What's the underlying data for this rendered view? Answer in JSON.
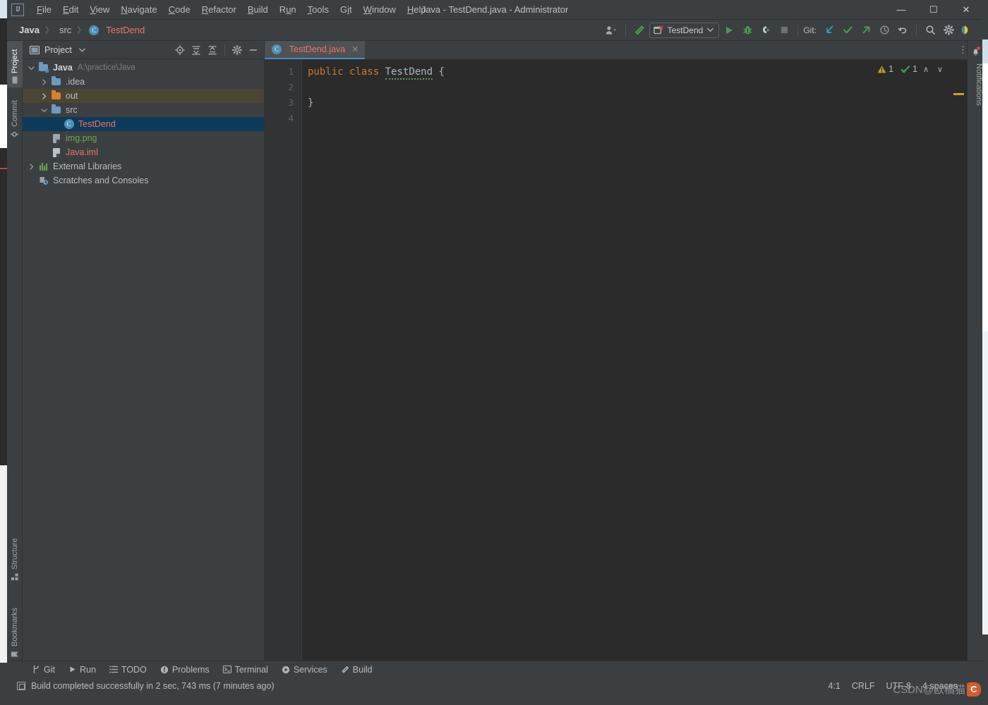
{
  "window": {
    "title": "Java - TestDend.java - Administrator",
    "logo_text": "IJ",
    "minimize": "—",
    "maximize": "☐",
    "close": "✕"
  },
  "menu": [
    {
      "label": "File",
      "mnemonic": "F"
    },
    {
      "label": "Edit",
      "mnemonic": "E"
    },
    {
      "label": "View",
      "mnemonic": "V"
    },
    {
      "label": "Navigate",
      "mnemonic": "N"
    },
    {
      "label": "Code",
      "mnemonic": "C"
    },
    {
      "label": "Refactor",
      "mnemonic": "R"
    },
    {
      "label": "Build",
      "mnemonic": "B"
    },
    {
      "label": "Run",
      "mnemonic": "u"
    },
    {
      "label": "Tools",
      "mnemonic": "T"
    },
    {
      "label": "Git",
      "mnemonic": "G"
    },
    {
      "label": "Window",
      "mnemonic": "W"
    },
    {
      "label": "Help",
      "mnemonic": "H"
    }
  ],
  "breadcrumb": {
    "project": "Java",
    "folder": "src",
    "file": "TestDend",
    "class_badge": "C",
    "separator": "〉"
  },
  "toolbar": {
    "run_config": "TestDend",
    "git_label": "Git:",
    "icons": [
      "user-switch-icon",
      "build-hammer-icon",
      "run-icon",
      "debug-icon",
      "run-coverage-icon",
      "stop-icon",
      "git-update-icon",
      "git-commit-icon",
      "git-push-icon",
      "git-history-icon",
      "git-rollback-icon",
      "search-everywhere-icon",
      "settings-gear-icon",
      "ide-assistant-icon"
    ]
  },
  "left_strip": {
    "tabs": [
      {
        "label": "Project",
        "icon": "project-folder-icon",
        "active": true
      },
      {
        "label": "Commit",
        "icon": "commit-icon",
        "active": false
      }
    ],
    "bottom_tabs": [
      {
        "label": "Structure",
        "icon": "structure-icon"
      },
      {
        "label": "Bookmarks",
        "icon": "bookmark-icon"
      }
    ]
  },
  "right_strip": {
    "notifications_label": "Notifications",
    "bell_icon": "bell-icon",
    "has_unread": true
  },
  "project_panel": {
    "title": "Project",
    "tools": [
      {
        "name": "select-opened-file-icon",
        "glyph": "⊕"
      },
      {
        "name": "expand-all-icon",
        "glyph": "⩛"
      },
      {
        "name": "collapse-all-icon",
        "glyph": "⩜"
      },
      {
        "name": "settings-gear-icon",
        "glyph": "⚙"
      },
      {
        "name": "hide-panel-icon",
        "glyph": "—"
      }
    ],
    "tree": [
      {
        "label": "Java",
        "sub": "A:\\practice\\Java",
        "indent": 0,
        "twisty": "expanded",
        "icon": "module-folder-icon",
        "style": "bold",
        "state": "normal"
      },
      {
        "label": ".idea",
        "sub": "",
        "indent": 1,
        "twisty": "collapsed",
        "icon": "folder-icon",
        "style": "",
        "state": "normal"
      },
      {
        "label": "out",
        "sub": "",
        "indent": 1,
        "twisty": "collapsed",
        "icon": "folder-orange-icon",
        "style": "",
        "state": "highlighted"
      },
      {
        "label": "src",
        "sub": "",
        "indent": 1,
        "twisty": "expanded",
        "icon": "folder-icon",
        "style": "",
        "state": "normal"
      },
      {
        "label": "TestDend",
        "sub": "",
        "indent": 2,
        "twisty": "none",
        "icon": "java-class-icon",
        "style": "class",
        "state": "selected"
      },
      {
        "label": "img.png",
        "sub": "",
        "indent": 1,
        "twisty": "none",
        "icon": "image-file-icon",
        "style": "green",
        "state": "normal"
      },
      {
        "label": "Java.iml",
        "sub": "",
        "indent": 1,
        "twisty": "none",
        "icon": "iml-file-icon",
        "style": "red",
        "state": "normal"
      },
      {
        "label": "External Libraries",
        "sub": "",
        "indent": 0,
        "twisty": "collapsed",
        "icon": "libraries-icon",
        "style": "",
        "state": "normal"
      },
      {
        "label": "Scratches and Consoles",
        "sub": "",
        "indent": 0,
        "twisty": "none",
        "icon": "scratches-icon",
        "style": "",
        "state": "normal"
      }
    ]
  },
  "editor": {
    "tab": {
      "label": "TestDend.java",
      "badge": "C",
      "close": "✕"
    },
    "more_icon": "⋮",
    "line_numbers": [
      "1",
      "2",
      "3",
      "4"
    ],
    "code_lines": [
      {
        "segments": [
          {
            "text": "public",
            "type": "keyword"
          },
          {
            "text": " ",
            "type": "plain"
          },
          {
            "text": "class",
            "type": "keyword"
          },
          {
            "text": " ",
            "type": "plain"
          },
          {
            "text": "TestDend",
            "type": "classname"
          },
          {
            "text": " {",
            "type": "plain"
          }
        ]
      },
      {
        "segments": []
      },
      {
        "segments": [
          {
            "text": "}",
            "type": "plain"
          }
        ]
      },
      {
        "segments": []
      }
    ],
    "inspections": {
      "warning_count": "1",
      "ok_count": "1",
      "prev_glyph": "∧",
      "next_glyph": "∨"
    }
  },
  "tool_windows": [
    {
      "label": "Git",
      "icon": "git-branch-icon"
    },
    {
      "label": "Run",
      "icon": "run-icon"
    },
    {
      "label": "TODO",
      "icon": "todo-list-icon"
    },
    {
      "label": "Problems",
      "icon": "problems-icon"
    },
    {
      "label": "Terminal",
      "icon": "terminal-icon"
    },
    {
      "label": "Services",
      "icon": "services-icon"
    },
    {
      "label": "Build",
      "icon": "build-hammer-icon"
    }
  ],
  "status_bar": {
    "message": "Build completed successfully in 2 sec, 743 ms (7 minutes ago)",
    "caret_position": "4:1",
    "line_separator": "CRLF",
    "encoding": "UTF-8",
    "indent": "4 spaces",
    "lock_icon": "lock-icon"
  },
  "watermark": {
    "text": "CSDN@欧橘猫",
    "logo": "C"
  },
  "colors": {
    "panel_bg": "#3c3f41",
    "editor_bg": "#2b2b2b",
    "gutter_bg": "#313335",
    "selection_blue": "#0d3a58",
    "tab_underline": "#4a88c7",
    "keyword_orange": "#cc7832",
    "text_red": "#e8756b",
    "text_green": "#6aa84f",
    "warning_yellow": "#c9a227",
    "folder_blue": "#6e9bbd",
    "folder_orange": "#d98131"
  }
}
